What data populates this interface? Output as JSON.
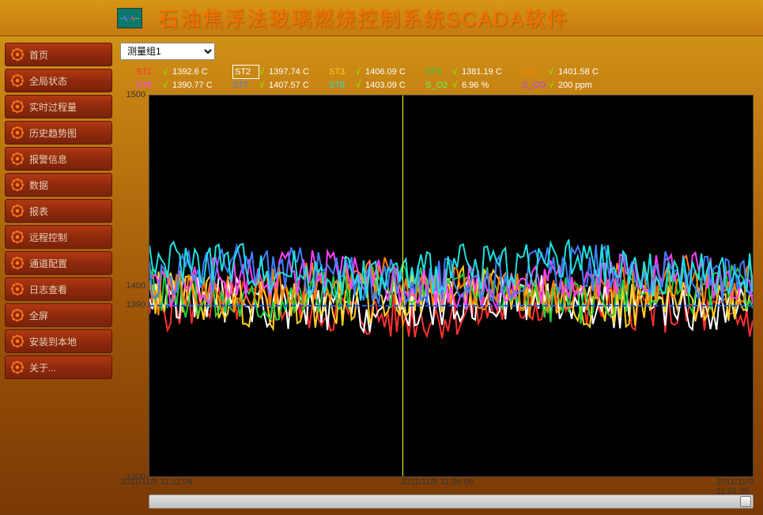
{
  "header": {
    "title": "石油焦浮法玻璃燃烧控制系统SCADA软件"
  },
  "sidebar": {
    "items": [
      {
        "label": "首页"
      },
      {
        "label": "全局状态"
      },
      {
        "label": "实时过程量"
      },
      {
        "label": "历史趋势图"
      },
      {
        "label": "报警信息"
      },
      {
        "label": "数据"
      },
      {
        "label": "报表"
      },
      {
        "label": "远程控制"
      },
      {
        "label": "通道配置"
      },
      {
        "label": "日志查看"
      },
      {
        "label": "全屏"
      },
      {
        "label": "安装到本地"
      },
      {
        "label": "关于..."
      }
    ]
  },
  "dropdown": {
    "selected": "测量组1"
  },
  "legend": {
    "row1": [
      {
        "name": "ST1",
        "color": "#ff3030",
        "value": "1392.6 C"
      },
      {
        "name": "ST2",
        "color": "#ffffff",
        "value": "1397.74 C",
        "boxed": true
      },
      {
        "name": "ST3",
        "color": "#ffd020",
        "value": "1406.09 C"
      },
      {
        "name": "ST4",
        "color": "#20d040",
        "value": "1381.19 C"
      },
      {
        "name": "ST5",
        "color": "#ff8000",
        "value": "1401.58 C"
      }
    ],
    "row2": [
      {
        "name": "ST6",
        "color": "#ff40ff",
        "value": "1390.77 C"
      },
      {
        "name": "ST7",
        "color": "#4080ff",
        "value": "1407.57 C"
      },
      {
        "name": "ST8",
        "color": "#20e0e0",
        "value": "1403.09 C"
      },
      {
        "name": "S_O2",
        "color": "#60ff60",
        "value": "6.96 %"
      },
      {
        "name": "S_CO",
        "color": "#b040ff",
        "value": "200 ppm"
      }
    ]
  },
  "chart_data": {
    "type": "line",
    "ylim": [
      1300,
      1500
    ],
    "y_ticks": [
      1300,
      1390,
      1400,
      1500
    ],
    "dash_ref": 1390,
    "cursor_x_frac": 0.42,
    "x_ticks": [
      {
        "frac": 0.0,
        "label": "2011/11/9 11:11:06"
      },
      {
        "frac": 0.5,
        "label": "2011/11/9 11:06:06"
      },
      {
        "frac": 1.0,
        "label": "2011/11/9 11:01:06"
      }
    ],
    "series": [
      {
        "name": "ST1",
        "color": "#ff3030"
      },
      {
        "name": "ST2",
        "color": "#ffffff"
      },
      {
        "name": "ST3",
        "color": "#ffd020"
      },
      {
        "name": "ST4",
        "color": "#20d040"
      },
      {
        "name": "ST5",
        "color": "#ff8000"
      },
      {
        "name": "ST6",
        "color": "#ff40ff"
      },
      {
        "name": "ST7",
        "color": "#4080ff"
      },
      {
        "name": "ST8",
        "color": "#20e0e0"
      }
    ],
    "approx_band_center": 1398,
    "approx_band_halfwidth": 18
  }
}
